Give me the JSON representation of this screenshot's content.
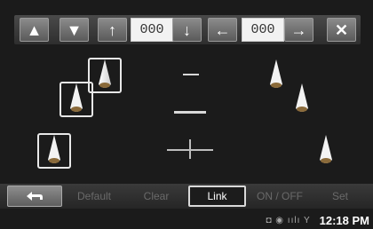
{
  "toolbar": {
    "up_label": "▲",
    "down_label": "▼",
    "front_arrow": "↑",
    "front_value": "000",
    "rear_arrow": "↓",
    "left_arrow": "←",
    "side_value": "000",
    "right_arrow": "→",
    "close_label": "✕"
  },
  "bottom": {
    "back_icon": "back-arrow-icon",
    "default_label": "Default",
    "clear_label": "Clear",
    "link_label": "Link",
    "onoff_label": "ON / OFF",
    "set_label": "Set"
  },
  "status": {
    "icons": "◘ ◉ ıılı Y",
    "time": "12:18 PM"
  },
  "colors": {
    "active_border": "#d9d9d9",
    "disabled_text": "#6a6a6a"
  }
}
